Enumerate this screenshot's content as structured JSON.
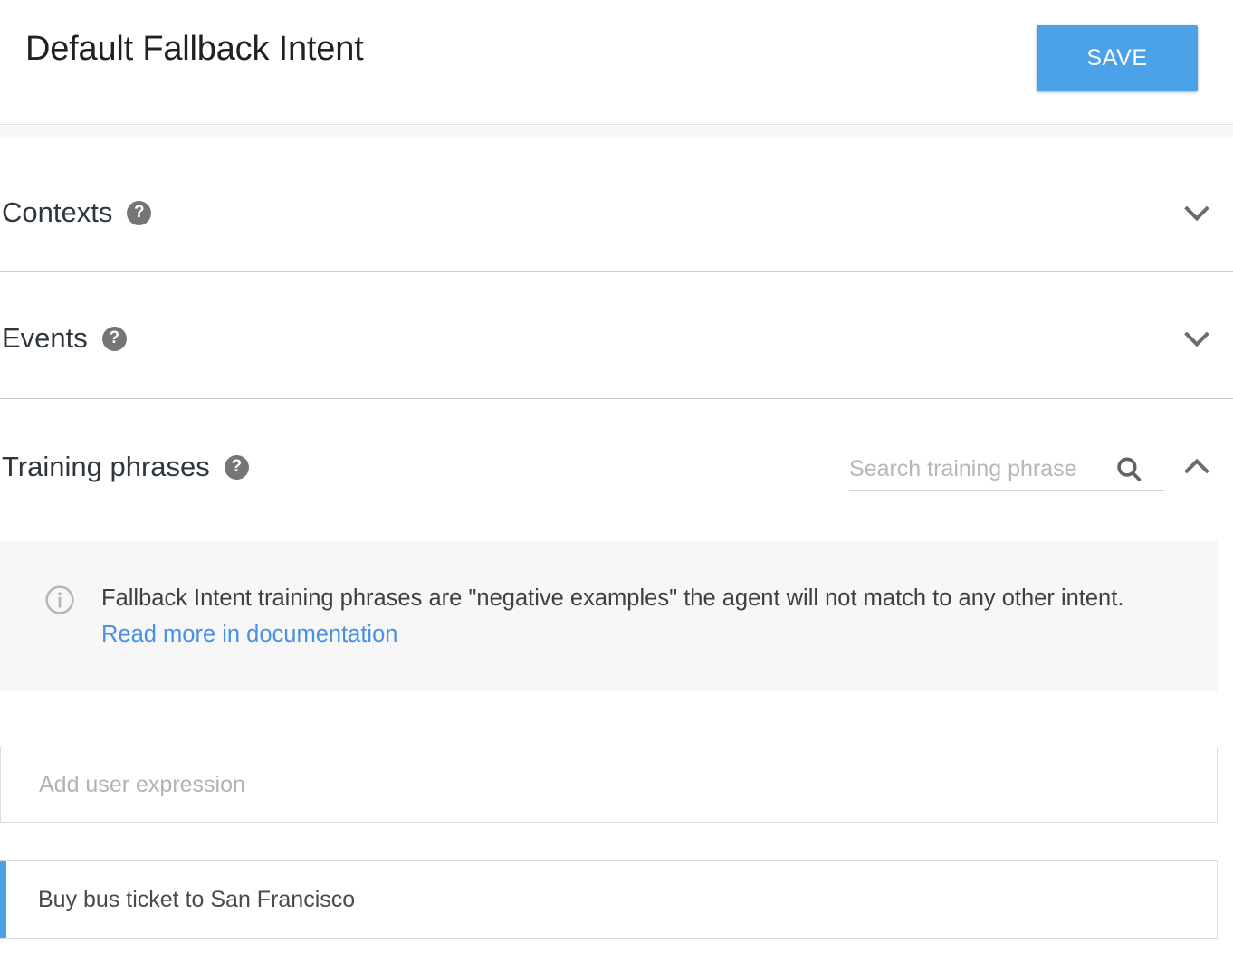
{
  "header": {
    "title": "Default Fallback Intent",
    "save_label": "SAVE"
  },
  "sections": [
    {
      "id": "contexts",
      "label": "Contexts",
      "help_icon": "help-circle-icon",
      "chevron": "chevron-down-icon",
      "expanded": false
    },
    {
      "id": "events",
      "label": "Events",
      "help_icon": "help-circle-icon",
      "chevron": "chevron-down-icon",
      "expanded": false
    },
    {
      "id": "training-phrases",
      "label": "Training phrases",
      "help_icon": "help-circle-icon",
      "chevron": "chevron-up-icon",
      "expanded": true
    }
  ],
  "search": {
    "placeholder": "Search training phrase",
    "value": "",
    "icon": "search-icon"
  },
  "info_banner": {
    "icon": "info-circle-icon",
    "text_before": "Fallback Intent training phrases are \"negative examples\" the agent will not match to any other intent. ",
    "link_text": "Read more in documentation"
  },
  "add_expression": {
    "placeholder": "Add user expression",
    "value": ""
  },
  "training_phrases": [
    {
      "text": "Buy bus ticket to San Francisco",
      "accent_color": "#4ba2e8"
    }
  ],
  "colors": {
    "accent_blue": "#4ba2e8",
    "link_blue": "#4a90e2",
    "banner_bg": "#f7f7f7",
    "divider": "#cdcbcc",
    "icon_gray": "#757575"
  }
}
